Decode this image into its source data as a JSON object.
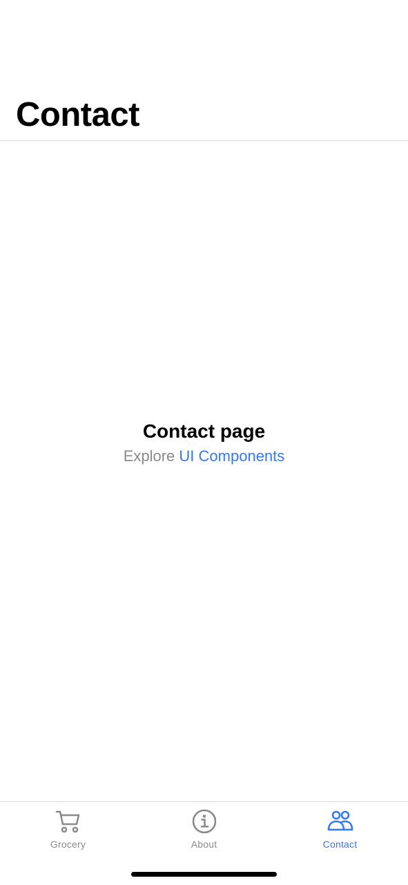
{
  "header": {
    "title": "Contact"
  },
  "content": {
    "title": "Contact page",
    "subtitle_prefix": "Explore",
    "subtitle_link": "UI Components"
  },
  "tabbar": {
    "tabs": [
      {
        "label": "Grocery",
        "icon": "cart-icon",
        "active": false
      },
      {
        "label": "About",
        "icon": "info-icon",
        "active": false
      },
      {
        "label": "Contact",
        "icon": "people-icon",
        "active": true
      }
    ]
  },
  "colors": {
    "accent": "#3478f6",
    "inactive": "#8a8a8e",
    "divider": "#d9d9d9"
  }
}
